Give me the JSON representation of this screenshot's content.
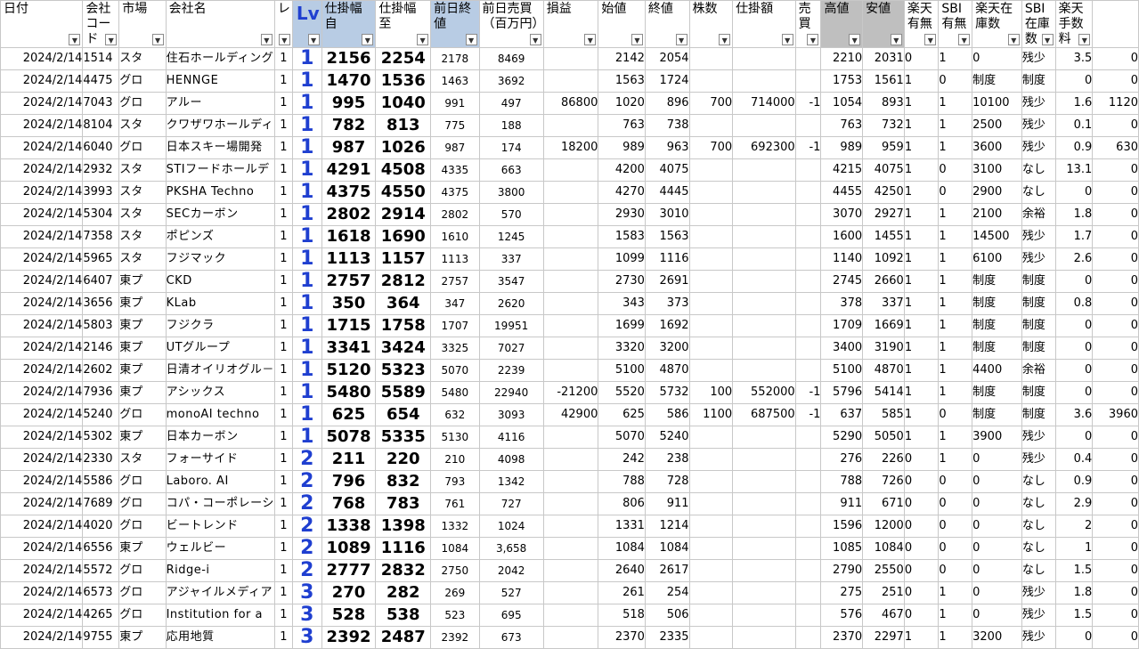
{
  "headers": [
    {
      "label": "日付",
      "style": ""
    },
    {
      "label": "会社コード",
      "style": ""
    },
    {
      "label": "市場",
      "style": ""
    },
    {
      "label": "会社名",
      "style": ""
    },
    {
      "label": "レ",
      "style": ""
    },
    {
      "label": "Lv",
      "style": "lv hl"
    },
    {
      "label": "仕掛幅自",
      "style": "hl"
    },
    {
      "label": "仕掛幅至",
      "style": ""
    },
    {
      "label": "前日終値",
      "style": "hl"
    },
    {
      "label": "前日売買（百万円）",
      "style": ""
    },
    {
      "label": "損益",
      "style": ""
    },
    {
      "label": "始値",
      "style": ""
    },
    {
      "label": "終値",
      "style": ""
    },
    {
      "label": "株数",
      "style": ""
    },
    {
      "label": "仕掛額",
      "style": ""
    },
    {
      "label": "売買",
      "style": ""
    },
    {
      "label": "高値",
      "style": "gr"
    },
    {
      "label": "安値",
      "style": "gr"
    },
    {
      "label": "楽天有無",
      "style": ""
    },
    {
      "label": "SBI有無",
      "style": ""
    },
    {
      "label": "楽天在庫数",
      "style": ""
    },
    {
      "label": "SBI在庫数",
      "style": ""
    },
    {
      "label": "楽天手数料",
      "style": ""
    },
    {
      "label": "",
      "style": ""
    }
  ],
  "rows": [
    [
      "2024/2/14",
      "1514",
      "スタ",
      "住石ホールディング",
      "1",
      "1",
      "2156",
      "2254",
      "2178",
      "8469",
      "",
      "2142",
      "2054",
      "",
      "",
      "",
      "2210",
      "2031",
      "0",
      "1",
      "0",
      "残少",
      "3.5",
      "0"
    ],
    [
      "2024/2/14",
      "4475",
      "グロ",
      "HENNGE",
      "1",
      "1",
      "1470",
      "1536",
      "1463",
      "3692",
      "",
      "1563",
      "1724",
      "",
      "",
      "",
      "1753",
      "1561",
      "1",
      "0",
      "制度",
      "制度",
      "0",
      "0"
    ],
    [
      "2024/2/14",
      "7043",
      "グロ",
      "アルー",
      "1",
      "1",
      "995",
      "1040",
      "991",
      "497",
      "86800",
      "1020",
      "896",
      "700",
      "714000",
      "-1",
      "1054",
      "893",
      "1",
      "1",
      "10100",
      "残少",
      "1.6",
      "1120"
    ],
    [
      "2024/2/14",
      "8104",
      "スタ",
      "クワザワホールディ",
      "1",
      "1",
      "782",
      "813",
      "775",
      "188",
      "",
      "763",
      "738",
      "",
      "",
      "",
      "763",
      "732",
      "1",
      "1",
      "2500",
      "残少",
      "0.1",
      "0"
    ],
    [
      "2024/2/14",
      "6040",
      "グロ",
      "日本スキー場開発",
      "1",
      "1",
      "987",
      "1026",
      "987",
      "174",
      "18200",
      "989",
      "963",
      "700",
      "692300",
      "-1",
      "989",
      "959",
      "1",
      "1",
      "3600",
      "残少",
      "0.9",
      "630"
    ],
    [
      "2024/2/14",
      "2932",
      "スタ",
      "STIフードホールデ",
      "1",
      "1",
      "4291",
      "4508",
      "4335",
      "663",
      "",
      "4200",
      "4075",
      "",
      "",
      "",
      "4215",
      "4075",
      "1",
      "0",
      "3100",
      "なし",
      "13.1",
      "0"
    ],
    [
      "2024/2/14",
      "3993",
      "スタ",
      "PKSHA Techno",
      "1",
      "1",
      "4375",
      "4550",
      "4375",
      "3800",
      "",
      "4270",
      "4445",
      "",
      "",
      "",
      "4455",
      "4250",
      "1",
      "0",
      "2900",
      "なし",
      "0",
      "0"
    ],
    [
      "2024/2/14",
      "5304",
      "スタ",
      "SECカーボン",
      "1",
      "1",
      "2802",
      "2914",
      "2802",
      "570",
      "",
      "2930",
      "3010",
      "",
      "",
      "",
      "3070",
      "2927",
      "1",
      "1",
      "2100",
      "余裕",
      "1.8",
      "0"
    ],
    [
      "2024/2/14",
      "7358",
      "スタ",
      "ポピンズ",
      "1",
      "1",
      "1618",
      "1690",
      "1610",
      "1245",
      "",
      "1583",
      "1563",
      "",
      "",
      "",
      "1600",
      "1455",
      "1",
      "1",
      "14500",
      "残少",
      "1.7",
      "0"
    ],
    [
      "2024/2/14",
      "5965",
      "スタ",
      "フジマック",
      "1",
      "1",
      "1113",
      "1157",
      "1113",
      "337",
      "",
      "1099",
      "1116",
      "",
      "",
      "",
      "1140",
      "1092",
      "1",
      "1",
      "6100",
      "残少",
      "2.6",
      "0"
    ],
    [
      "2024/2/14",
      "6407",
      "東プ",
      "CKD",
      "1",
      "1",
      "2757",
      "2812",
      "2757",
      "3547",
      "",
      "2730",
      "2691",
      "",
      "",
      "",
      "2745",
      "2660",
      "1",
      "1",
      "制度",
      "制度",
      "0",
      "0"
    ],
    [
      "2024/2/14",
      "3656",
      "東プ",
      "KLab",
      "1",
      "1",
      "350",
      "364",
      "347",
      "2620",
      "",
      "343",
      "373",
      "",
      "",
      "",
      "378",
      "337",
      "1",
      "1",
      "制度",
      "制度",
      "0.8",
      "0"
    ],
    [
      "2024/2/14",
      "5803",
      "東プ",
      "フジクラ",
      "1",
      "1",
      "1715",
      "1758",
      "1707",
      "19951",
      "",
      "1699",
      "1692",
      "",
      "",
      "",
      "1709",
      "1669",
      "1",
      "1",
      "制度",
      "制度",
      "0",
      "0"
    ],
    [
      "2024/2/14",
      "2146",
      "東プ",
      "UTグループ",
      "1",
      "1",
      "3341",
      "3424",
      "3325",
      "7027",
      "",
      "3320",
      "3200",
      "",
      "",
      "",
      "3400",
      "3190",
      "1",
      "1",
      "制度",
      "制度",
      "0",
      "0"
    ],
    [
      "2024/2/14",
      "2602",
      "東プ",
      "日清オイリオグル－",
      "1",
      "1",
      "5120",
      "5323",
      "5070",
      "2239",
      "",
      "5100",
      "4870",
      "",
      "",
      "",
      "5100",
      "4870",
      "1",
      "1",
      "4400",
      "余裕",
      "0",
      "0"
    ],
    [
      "2024/2/14",
      "7936",
      "東プ",
      "アシックス",
      "1",
      "1",
      "5480",
      "5589",
      "5480",
      "22940",
      "-21200",
      "5520",
      "5732",
      "100",
      "552000",
      "-1",
      "5796",
      "5414",
      "1",
      "1",
      "制度",
      "制度",
      "0",
      "0"
    ],
    [
      "2024/2/14",
      "5240",
      "グロ",
      "monoAI techno",
      "1",
      "1",
      "625",
      "654",
      "632",
      "3093",
      "42900",
      "625",
      "586",
      "1100",
      "687500",
      "-1",
      "637",
      "585",
      "1",
      "0",
      "制度",
      "制度",
      "3.6",
      "3960"
    ],
    [
      "2024/2/14",
      "5302",
      "東プ",
      "日本カーボン",
      "1",
      "1",
      "5078",
      "5335",
      "5130",
      "4116",
      "",
      "5070",
      "5240",
      "",
      "",
      "",
      "5290",
      "5050",
      "1",
      "1",
      "3900",
      "残少",
      "0",
      "0"
    ],
    [
      "2024/2/14",
      "2330",
      "スタ",
      "フォーサイド",
      "1",
      "2",
      "211",
      "220",
      "210",
      "4098",
      "",
      "242",
      "238",
      "",
      "",
      "",
      "276",
      "226",
      "0",
      "1",
      "0",
      "残少",
      "0.4",
      "0"
    ],
    [
      "2024/2/14",
      "5586",
      "グロ",
      "Laboro. AI",
      "1",
      "2",
      "796",
      "832",
      "793",
      "1342",
      "",
      "788",
      "728",
      "",
      "",
      "",
      "788",
      "726",
      "0",
      "0",
      "0",
      "なし",
      "0.9",
      "0"
    ],
    [
      "2024/2/14",
      "7689",
      "グロ",
      "コパ・コーポレーシ",
      "1",
      "2",
      "768",
      "783",
      "761",
      "727",
      "",
      "806",
      "911",
      "",
      "",
      "",
      "911",
      "671",
      "0",
      "0",
      "0",
      "なし",
      "2.9",
      "0"
    ],
    [
      "2024/2/14",
      "4020",
      "グロ",
      "ビートレンド",
      "1",
      "2",
      "1338",
      "1398",
      "1332",
      "1024",
      "",
      "1331",
      "1214",
      "",
      "",
      "",
      "1596",
      "1200",
      "0",
      "0",
      "0",
      "なし",
      "2",
      "0"
    ],
    [
      "2024/2/14",
      "6556",
      "東プ",
      "ウェルビー",
      "1",
      "2",
      "1089",
      "1116",
      "1084",
      "3,658",
      "",
      "1084",
      "1084",
      "",
      "",
      "",
      "1085",
      "1084",
      "0",
      "0",
      "0",
      "なし",
      "1",
      "0"
    ],
    [
      "2024/2/14",
      "5572",
      "グロ",
      "Ridge-i",
      "1",
      "2",
      "2777",
      "2832",
      "2750",
      "2042",
      "",
      "2640",
      "2617",
      "",
      "",
      "",
      "2790",
      "2550",
      "0",
      "0",
      "0",
      "なし",
      "1.5",
      "0"
    ],
    [
      "2024/2/14",
      "6573",
      "グロ",
      "アジャイルメディア",
      "1",
      "3",
      "270",
      "282",
      "269",
      "527",
      "",
      "261",
      "254",
      "",
      "",
      "",
      "275",
      "251",
      "0",
      "1",
      "0",
      "残少",
      "1.8",
      "0"
    ],
    [
      "2024/2/14",
      "4265",
      "グロ",
      "Institution for a",
      "1",
      "3",
      "528",
      "538",
      "523",
      "695",
      "",
      "518",
      "506",
      "",
      "",
      "",
      "576",
      "467",
      "0",
      "1",
      "0",
      "残少",
      "1.5",
      "0"
    ],
    [
      "2024/2/14",
      "9755",
      "東プ",
      "応用地質",
      "1",
      "3",
      "2392",
      "2487",
      "2392",
      "673",
      "",
      "2370",
      "2335",
      "",
      "",
      "",
      "2370",
      "2297",
      "1",
      "1",
      "3200",
      "残少",
      "0",
      "0"
    ]
  ],
  "filter_icon": "dropdown-arrow-icon"
}
